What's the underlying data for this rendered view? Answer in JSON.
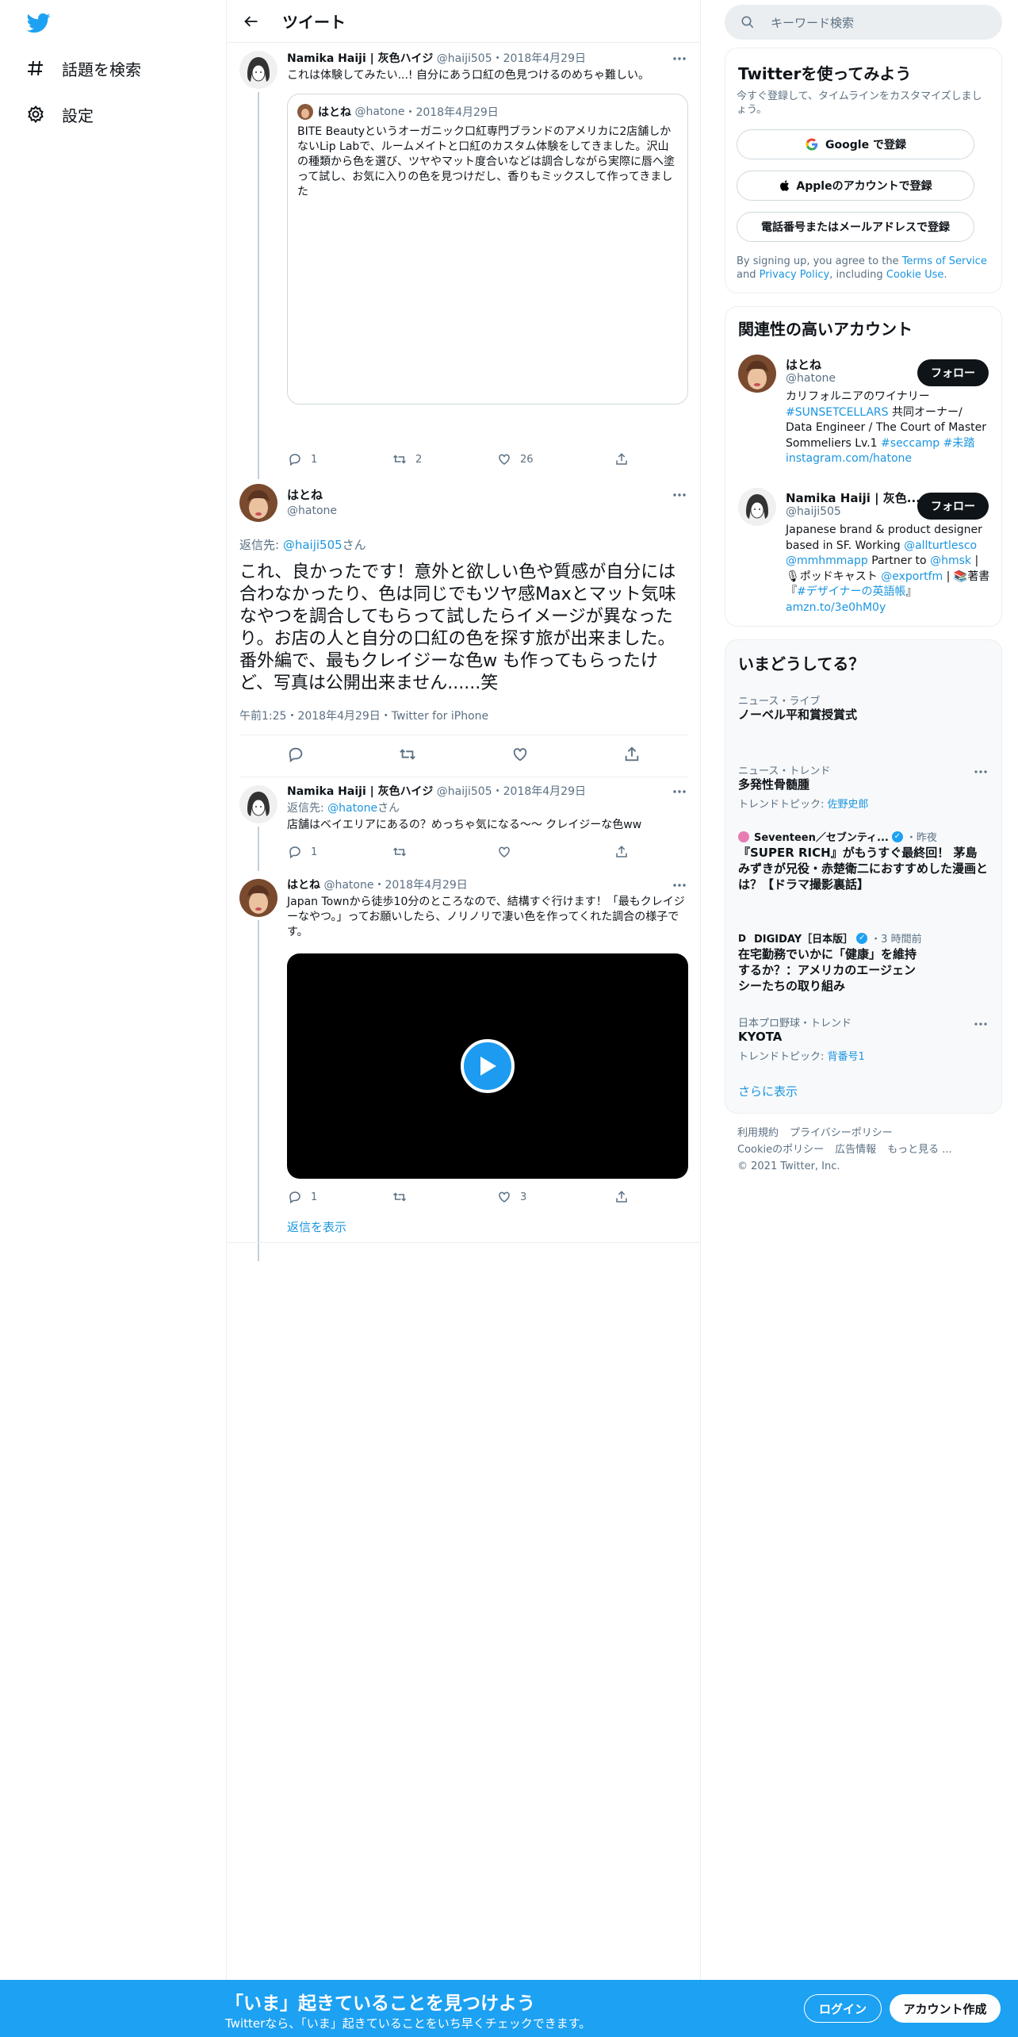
{
  "sidebar": {
    "items": [
      {
        "label": "話題を検索",
        "icon": "hashtag-icon"
      },
      {
        "label": "設定",
        "icon": "gear-icon"
      }
    ]
  },
  "header": {
    "title": "ツイート"
  },
  "tweets": [
    {
      "name": "Namika Haiji | 灰色ハイジ",
      "handle": "@haiji505",
      "date": "2018年4月29日",
      "text": "これは体験してみたい...! 自分にあう口紅の色見つけるのめちゃ難しい。",
      "quote": {
        "name": "はとね",
        "handle": "@hatone",
        "date": "2018年4月29日",
        "text": "BITE Beautyというオーガニック口紅専門ブランドのアメリカに2店舗しかないLip Labで、ルームメイトと口紅のカスタム体験をしてきました。沢山の種類から色を選び、ツヤやマット度合いなどは調合しながら実際に唇へ塗って試し、お気に入りの色を見つけだし、香りもミックスして作ってきました"
      },
      "replies": "1",
      "retweets": "2",
      "likes": "26"
    },
    {
      "name": "はとね",
      "handle": "@hatone",
      "reply_prefix": "返信先: ",
      "reply_to": "@haiji505",
      "reply_suffix": "さん",
      "text": "これ、良かったです！意外と欲しい色や質感が自分には合わなかったり、色は同じでもツヤ感Maxとマット気味なやつを調合してもらって試したらイメージが異なったり。お店の人と自分の口紅の色を探す旅が出来ました。番外編で、最もクレイジーな色w も作ってもらったけど、写真は公開出来ません......笑",
      "meta": "午前1:25・2018年4月29日・Twitter for iPhone"
    },
    {
      "name": "Namika Haiji | 灰色ハイジ",
      "handle": "@haiji505",
      "date": "2018年4月29日",
      "reply_prefix": "返信先: ",
      "reply_to": "@hatone",
      "reply_suffix": "さん",
      "text": "店舗はベイエリアにあるの？めっちゃ気になる〜〜 クレイジーな色ww",
      "replies": "1"
    },
    {
      "name": "はとね",
      "handle": "@hatone",
      "date": "2018年4月29日",
      "text": "Japan Townから徒歩10分のところなので、結構すぐ行けます！「最もクレイジーなやつ。」ってお願いしたら、ノリノリで凄い色を作ってくれた調合の様子です。",
      "replies": "1",
      "likes": "3",
      "show_replies": "返信を表示"
    }
  ],
  "right": {
    "search_placeholder": "キーワード検索",
    "signup": {
      "title": "Twitterを使ってみよう",
      "subtitle": "今すぐ登録して、タイムラインをカスタマイズしましょう。",
      "google": "Google で登録",
      "apple": "Appleのアカウントで登録",
      "phone": "電話番号またはメールアドレスで登録",
      "legal_1": "By signing up, you agree to the ",
      "terms": "Terms of Service",
      "legal_2": " and ",
      "privacy": "Privacy Policy",
      "legal_3": ", including ",
      "cookie": "Cookie Use",
      "legal_4": "."
    },
    "relevant": {
      "title": "関連性の高いアカウント",
      "follow": "フォロー",
      "accounts": [
        {
          "name": "はとね",
          "handle": "@hatone",
          "bio_parts": [
            "カリフォルニアのワイナリー",
            "#SUNSETCELLARS",
            " 共同オーナー/ Data Engineer / The Court of Master Sommeliers Lv.1 ",
            "#seccamp",
            " ",
            "#未踏",
            " ",
            "instagram.com/hatone"
          ]
        },
        {
          "name": "Namika Haiji | 灰色...",
          "handle": "@haiji505",
          "bio_parts": [
            "Japanese brand & product designer based in SF. Working ",
            "@allturtlesco",
            " ",
            "@mmhmmapp",
            " Partner to ",
            "@hmsk",
            " | 🎙ポッドキャスト ",
            "@exportfm",
            " | 📚著書『",
            "#デザイナーの英語帳",
            "』",
            "amzn.to/3e0hM0y"
          ]
        }
      ]
    },
    "trends": {
      "title": "いまどうしてる？",
      "items": [
        {
          "category": "ニュース・ライブ",
          "title": "ノーベル平和賞授賞式"
        },
        {
          "category": "ニュース・トレンド",
          "title": "多発性骨髄腫",
          "sub_prefix": "トレンドトピック: ",
          "sub_link": "佐野史郎"
        },
        {
          "category_source": "Seventeen／セブンティ...",
          "category_time": "・昨夜",
          "title": "『SUPER RICH』がもうすぐ最終回！ 茅島みずきが兄役・赤楚衛二におすすめした漫画とは？【ドラマ撮影裏話】"
        },
        {
          "category_source": "DIGIDAY［日本版］",
          "category_time": "・3 時間前",
          "title": "在宅勤務でいかに「健康」を維持するか？：アメリカのエージェンシーたちの取り組み"
        },
        {
          "category": "日本プロ野球・トレンド",
          "title": "KYOTA",
          "sub_prefix": "トレンドトピック: ",
          "sub_link": "背番号1"
        }
      ],
      "show_more": "さらに表示"
    },
    "footer": {
      "links": [
        "利用規約",
        "プライバシーポリシー",
        "Cookieのポリシー",
        "広告情報",
        "もっと見る ..."
      ],
      "copyright": "© 2021 Twitter, Inc."
    }
  },
  "bottom_bar": {
    "title": "「いま」起きていることを見つけよう",
    "subtitle": "Twitterなら、「いま」起きていることをいち早くチェックできます。",
    "login": "ログイン",
    "signup": "アカウント作成"
  },
  "colors": {
    "accent": "#1da1f2",
    "link": "#1b95e0",
    "muted": "#5b7083",
    "border": "#ebeef0"
  }
}
